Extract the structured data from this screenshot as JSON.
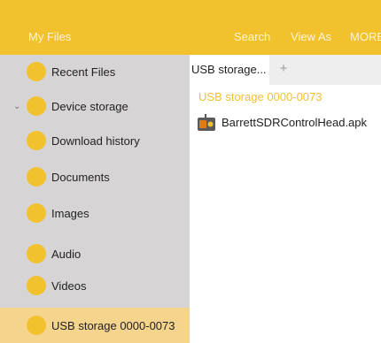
{
  "header": {
    "title": "My Files",
    "actions": {
      "search": "Search",
      "view_as": "View As",
      "more": "MORE"
    }
  },
  "sidebar": {
    "items": [
      {
        "label": "Recent Files"
      },
      {
        "label": "Device storage",
        "expandable": true
      },
      {
        "label": "Download history"
      },
      {
        "label": "Documents"
      },
      {
        "label": "Images"
      },
      {
        "label": "Audio"
      },
      {
        "label": "Videos"
      },
      {
        "label": "USB storage 0000-0073",
        "selected": true
      }
    ]
  },
  "tabs": [
    {
      "label": "USB storage...",
      "active": true
    }
  ],
  "tab_add": "+",
  "breadcrumb": "USB storage 0000-0073",
  "files": [
    {
      "name": "BarrettSDRControlHead.apk",
      "icon": "apk-file-icon"
    }
  ],
  "colors": {
    "accent": "#f2c12e",
    "sidebar_bg": "#d6d4d4",
    "selected_bg": "#f5d48e"
  }
}
